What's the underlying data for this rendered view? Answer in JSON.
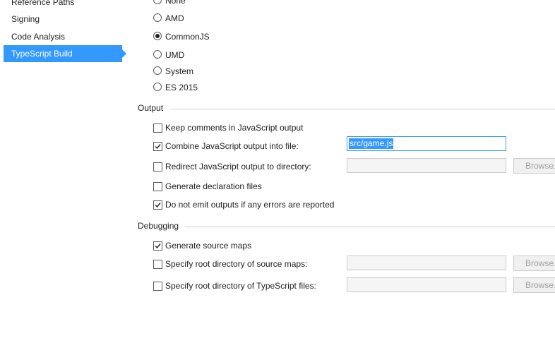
{
  "sidebar": {
    "items": [
      {
        "label": "Reference Paths"
      },
      {
        "label": "Signing"
      },
      {
        "label": "Code Analysis"
      },
      {
        "label": "TypeScript Build"
      }
    ]
  },
  "module_system": {
    "options": [
      {
        "label": "None",
        "selected": false
      },
      {
        "label": "AMD",
        "selected": false
      },
      {
        "label": "CommonJS",
        "selected": true
      },
      {
        "label": "UMD",
        "selected": false
      },
      {
        "label": "System",
        "selected": false
      },
      {
        "label": "ES 2015",
        "selected": false
      }
    ]
  },
  "output": {
    "title": "Output",
    "keep_comments": {
      "label": "Keep comments in JavaScript output",
      "checked": false
    },
    "combine": {
      "label": "Combine JavaScript output into file:",
      "checked": true,
      "value": "src/game.js"
    },
    "redirect": {
      "label": "Redirect JavaScript output to directory:",
      "checked": false,
      "value": "",
      "browse_label": "Browse..."
    },
    "declarations": {
      "label": "Generate declaration files",
      "checked": false
    },
    "no_emit_on_error": {
      "label": "Do not emit outputs if any errors are reported",
      "checked": true
    }
  },
  "debugging": {
    "title": "Debugging",
    "source_maps": {
      "label": "Generate source maps",
      "checked": true
    },
    "map_root": {
      "label": "Specify root directory of source maps:",
      "checked": false,
      "value": "",
      "browse_label": "Browse..."
    },
    "source_root": {
      "label": "Specify root directory of TypeScript files:",
      "checked": false,
      "value": "",
      "browse_label": "Browse..."
    }
  },
  "colors": {
    "accent": "#3399ff",
    "group_line": "#cccccc"
  }
}
